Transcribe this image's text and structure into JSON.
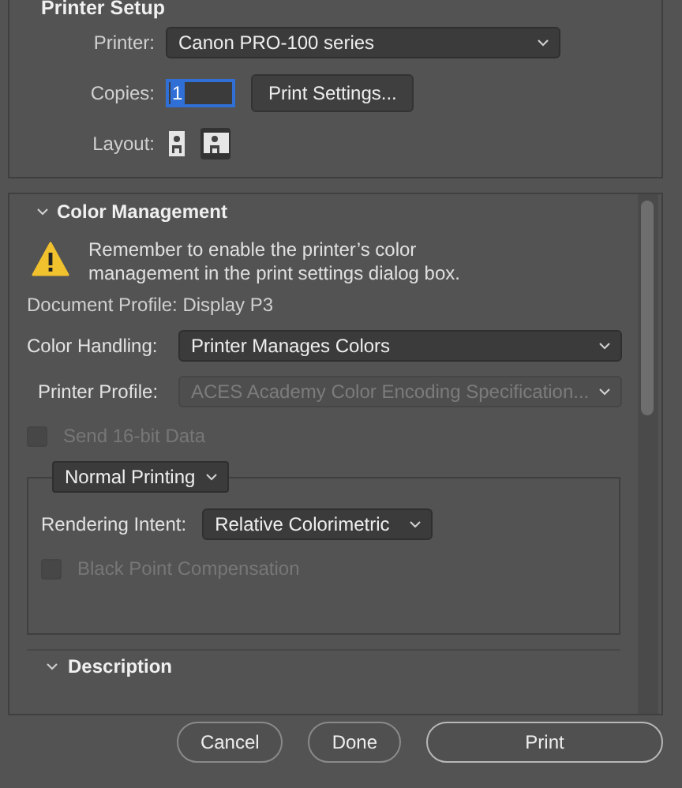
{
  "printer_setup": {
    "title": "Printer Setup",
    "printer": {
      "label": "Printer:",
      "value": "Canon PRO-100 series"
    },
    "copies": {
      "label": "Copies:",
      "value": "1",
      "focused": true
    },
    "print_settings_button": "Print Settings...",
    "layout": {
      "label": "Layout:",
      "options": [
        {
          "kind": "portrait",
          "selected": false
        },
        {
          "kind": "landscape",
          "selected": true
        }
      ]
    }
  },
  "color_management": {
    "title": "Color Management",
    "expanded": true,
    "warning": "Remember to enable the printer’s color management in the print settings dialog box.",
    "document_profile": "Document Profile: Display P3",
    "color_handling": {
      "label": "Color Handling:",
      "value": "Printer Manages Colors",
      "disabled": false
    },
    "printer_profile": {
      "label": "Printer Profile:",
      "value": "ACES Academy Color Encoding Specification...",
      "disabled": true
    },
    "send_16bit": {
      "label": "Send 16-bit Data",
      "checked": false,
      "disabled": true
    },
    "printing_mode": "Normal Printing",
    "rendering_intent": {
      "label": "Rendering Intent:",
      "value": "Relative Colorimetric",
      "disabled": false
    },
    "black_point": {
      "label": "Black Point Compensation",
      "checked": false,
      "disabled": true
    }
  },
  "description": {
    "title": "Description",
    "expanded": true
  },
  "buttons": [
    {
      "label": "Cancel",
      "kind": "secondary"
    },
    {
      "label": "Done",
      "kind": "secondary"
    },
    {
      "label": "Print",
      "kind": "primary"
    }
  ]
}
